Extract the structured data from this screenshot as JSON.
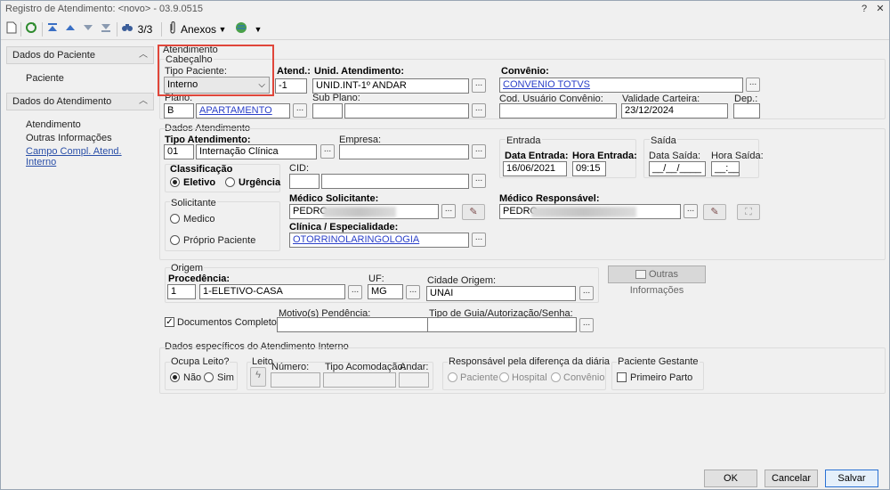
{
  "window": {
    "title": "Registro de Atendimento: <novo> - 03.9.0515",
    "help": "?",
    "close": "✕"
  },
  "toolbar": {
    "counter": "3/3",
    "attachments": "Anexos"
  },
  "sidebar": {
    "section1": "Dados do Paciente",
    "item_paciente": "Paciente",
    "section2": "Dados do Atendimento",
    "item_atendimento": "Atendimento",
    "item_outras": "Outras Informações",
    "item_campo": "Campo Compl. Atend. Interno"
  },
  "header": {
    "atendimento": "Atendimento",
    "cabecalho": "Cabeçalho",
    "tipo_paciente_label": "Tipo Paciente:",
    "tipo_paciente_value": "Interno",
    "atend_label": "Atend.:",
    "atend_value": "-1",
    "unid_label": "Unid. Atendimento:",
    "unid_value": "UNID.INT-1º ANDAR",
    "convenio_label": "Convênio:",
    "convenio_value": "CONVENIO TOTVS",
    "plano_label": "Plano:",
    "plano_code": "B",
    "plano_value": "APARTAMENTO",
    "subplano_label": "Sub Plano:",
    "cod_usuario_label": "Cod. Usuário Convênio:",
    "validade_label": "Validade Carteira:",
    "validade_value": "23/12/2024",
    "dep_label": "Dep.:"
  },
  "dados": {
    "title": "Dados Atendimento",
    "tipo_atend_label": "Tipo Atendimento:",
    "tipo_atend_code": "01",
    "tipo_atend_value": "Internação Clínica",
    "empresa_label": "Empresa:",
    "entrada_title": "Entrada",
    "data_entrada_label": "Data Entrada:",
    "data_entrada_value": "16/06/2021",
    "hora_entrada_label": "Hora Entrada:",
    "hora_entrada_value": "09:15",
    "saida_title": "Saída",
    "data_saida_label": "Data Saída:",
    "data_saida_value": "__/__/____",
    "hora_saida_label": "Hora Saída:",
    "hora_saida_value": "__:__",
    "classificacao_label": "Classificação",
    "eletivo": "Eletivo",
    "urgencia": "Urgência",
    "cid_label": "CID:",
    "solicitante_label": "Solicitante",
    "medico": "Medico",
    "proprio": "Próprio Paciente",
    "med_solic_label": "Médico Solicitante:",
    "med_solic_value": "PEDRO",
    "med_resp_label": "Médico Responsável:",
    "med_resp_value": "PEDRO",
    "clinica_label": "Clínica / Especialidade:",
    "clinica_value": "OTORRINOLARINGOLOGIA"
  },
  "origem": {
    "title": "Origem",
    "procedencia_label": "Procedência:",
    "procedencia_code": "1",
    "procedencia_value": "1-ELETIVO-CASA",
    "uf_label": "UF:",
    "uf_value": "MG",
    "cidade_label": "Cidade Origem:",
    "cidade_value": "UNAI",
    "outras_btn": "Outras Informações"
  },
  "docs": {
    "docs_label": "Documentos Completos ?",
    "motivo_label": "Motivo(s) Pendência:",
    "guia_label": "Tipo de Guia/Autorização/Senha:"
  },
  "interno": {
    "title": "Dados específicos do Atendimento Interno",
    "ocupa_label": "Ocupa Leito?",
    "nao": "Não",
    "sim": "Sim",
    "leito_label": "Leito",
    "numero_label": "Número:",
    "tipo_acom_label": "Tipo Acomodação:",
    "andar_label": "Andar:",
    "resp_label": "Responsável pela diferença da diária",
    "paciente": "Paciente",
    "hospital": "Hospital",
    "convenio": "Convênio",
    "gestante_label": "Paciente Gestante",
    "primeiro_parto": "Primeiro Parto"
  },
  "footer": {
    "ok": "OK",
    "cancelar": "Cancelar",
    "salvar": "Salvar"
  }
}
